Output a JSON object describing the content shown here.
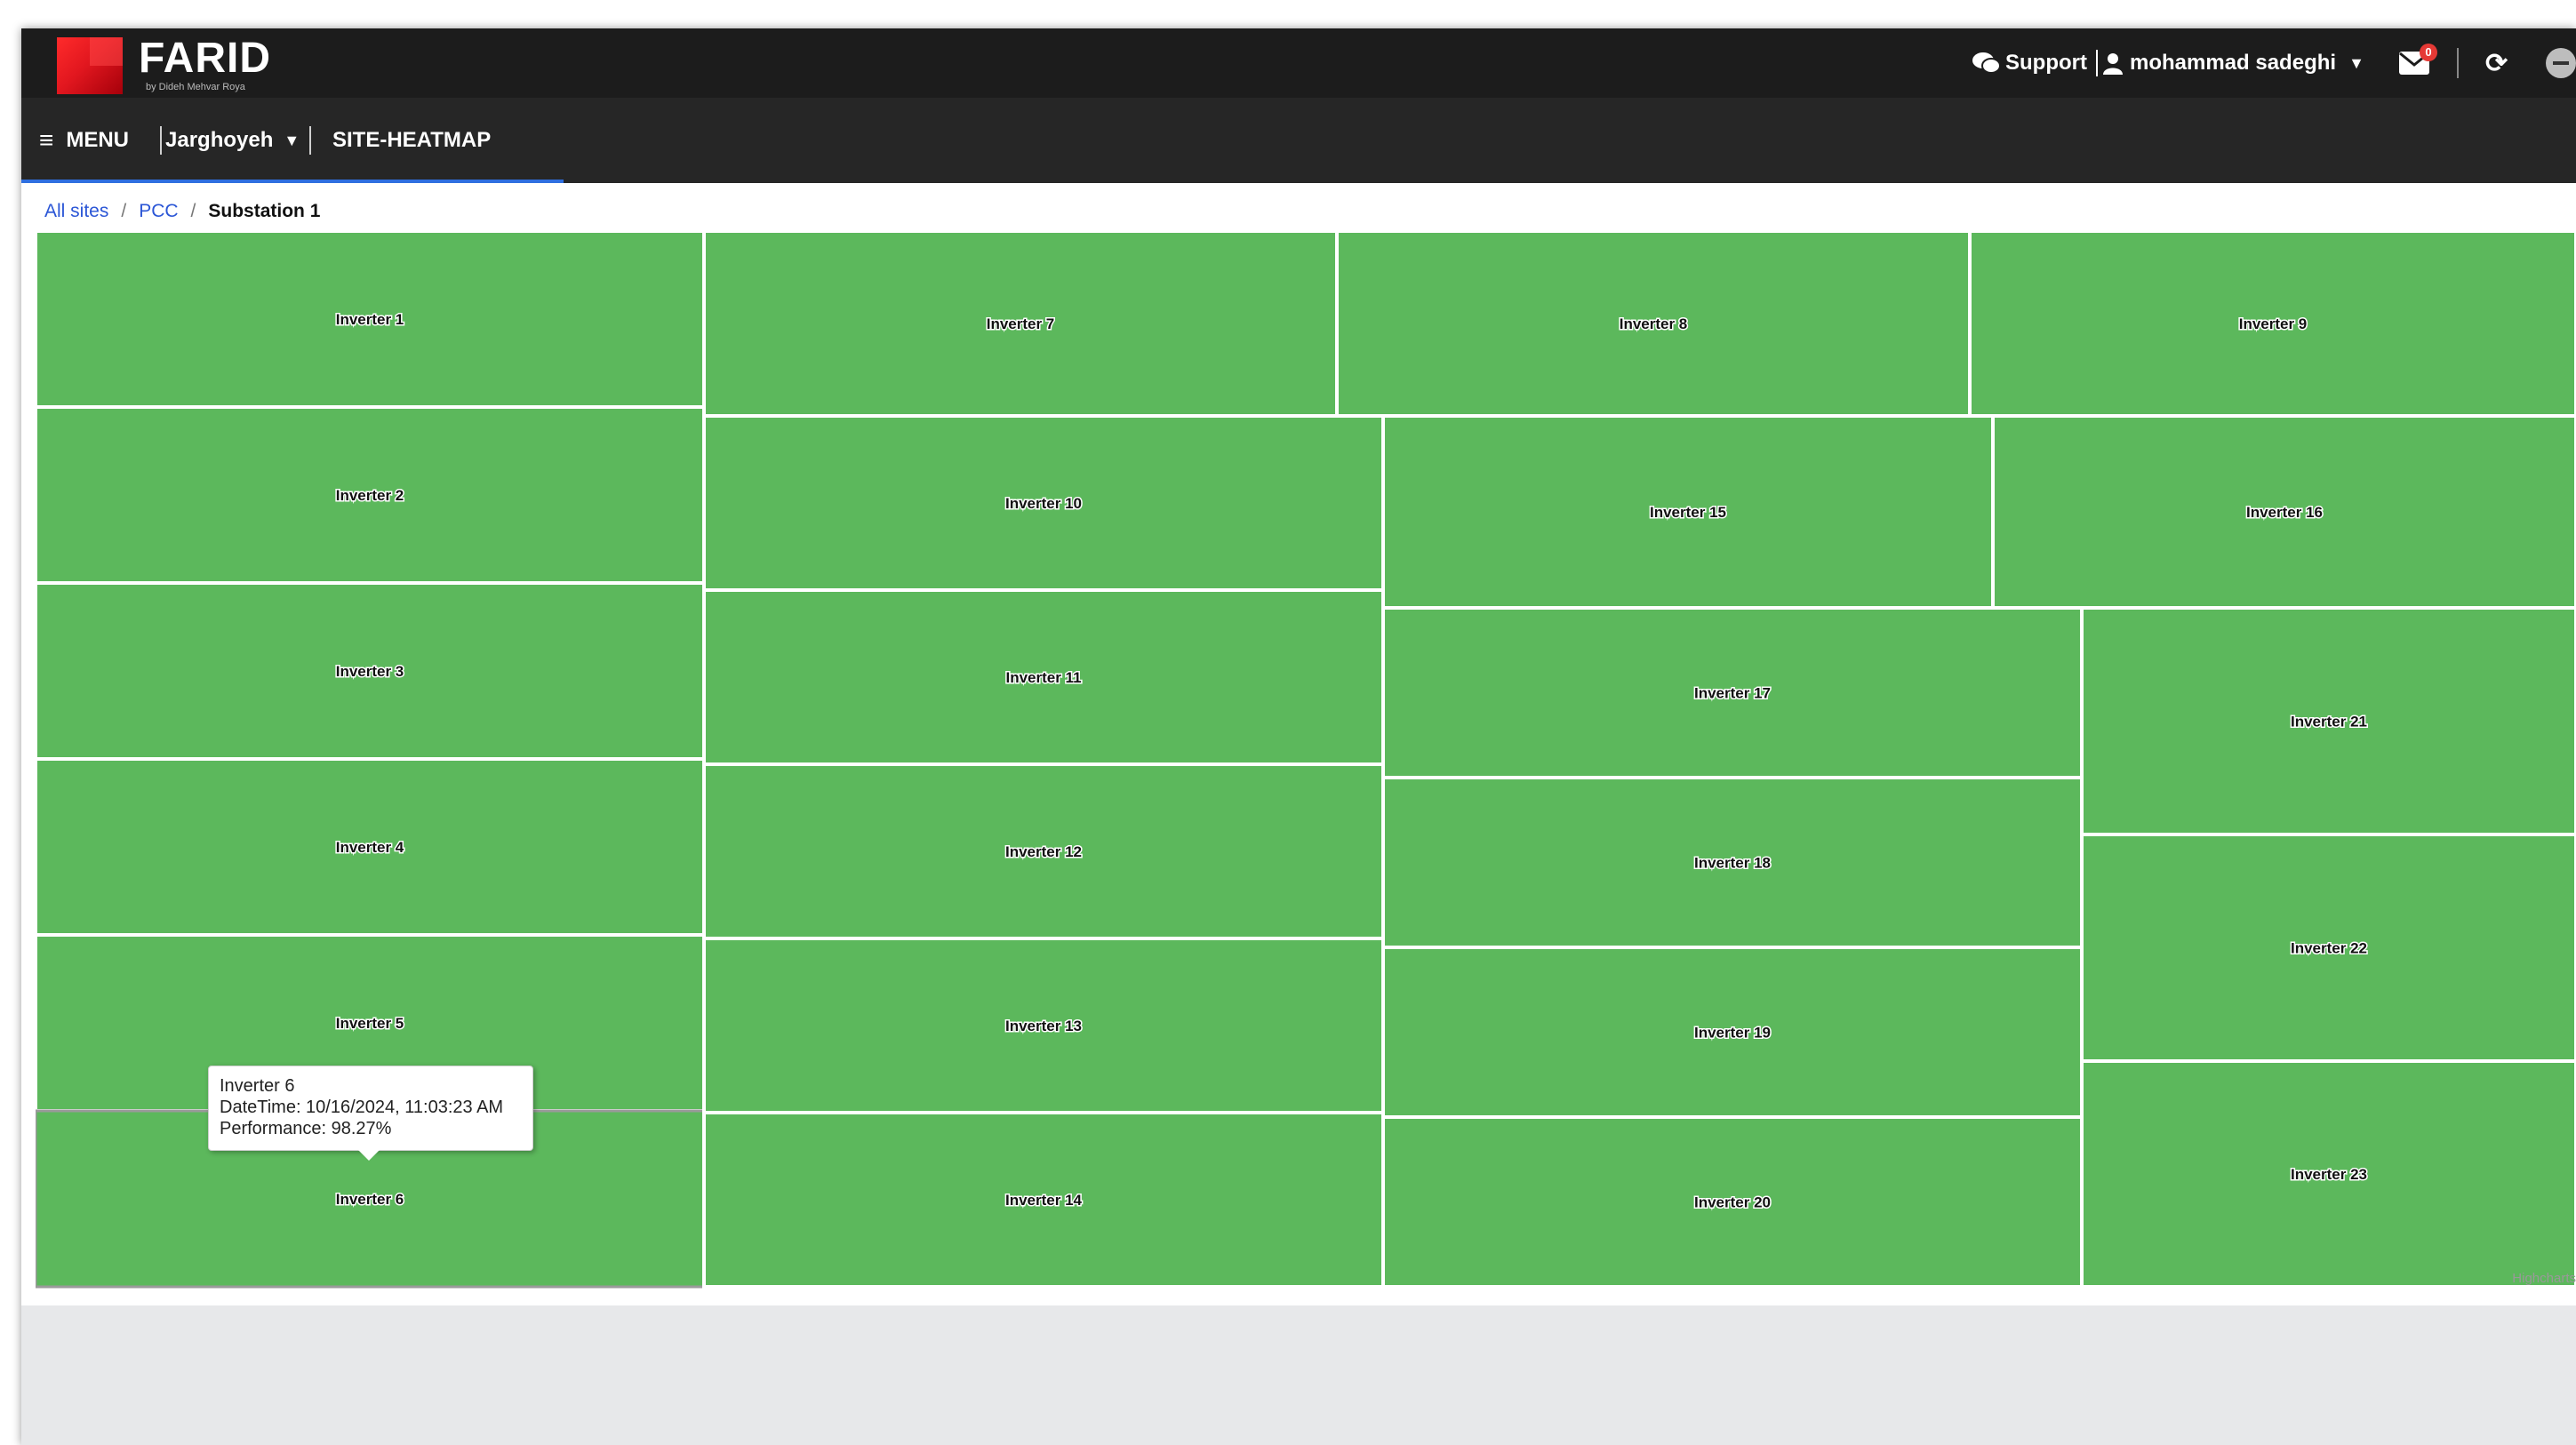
{
  "header": {
    "brand": "FARID",
    "brand_sub": "by Dideh Mehvar Roya",
    "support_label": "Support",
    "user_name": "mohammad sadeghi",
    "notification_count": "0"
  },
  "nav": {
    "menu_label": "MENU",
    "site_selector": "Jarghoyeh",
    "page_label": "SITE-HEATMAP"
  },
  "breadcrumb": {
    "all_sites": "All sites",
    "pcc": "PCC",
    "current": "Substation 1"
  },
  "tooltip": {
    "title": "Inverter 6",
    "datetime": "DateTime: 10/16/2024, 11:03:23 AM",
    "performance": "Performance: 98.27%"
  },
  "credits": "Highcharts",
  "colors": {
    "tile_green": "#5cb85c",
    "topbar": "#1c1c1c",
    "navbar": "#262626",
    "link": "#2b56d6"
  },
  "chart_data": {
    "type": "heatmap",
    "title": "",
    "cells": [
      {
        "name": "Inverter 1"
      },
      {
        "name": "Inverter 2"
      },
      {
        "name": "Inverter 3"
      },
      {
        "name": "Inverter 4"
      },
      {
        "name": "Inverter 5"
      },
      {
        "name": "Inverter 6",
        "datetime": "10/16/2024, 11:03:23 AM",
        "performance": 98.27
      },
      {
        "name": "Inverter 7"
      },
      {
        "name": "Inverter 8"
      },
      {
        "name": "Inverter 9"
      },
      {
        "name": "Inverter 10"
      },
      {
        "name": "Inverter 11"
      },
      {
        "name": "Inverter 12"
      },
      {
        "name": "Inverter 13"
      },
      {
        "name": "Inverter 14"
      },
      {
        "name": "Inverter 15"
      },
      {
        "name": "Inverter 16"
      },
      {
        "name": "Inverter 17"
      },
      {
        "name": "Inverter 18"
      },
      {
        "name": "Inverter 19"
      },
      {
        "name": "Inverter 20"
      },
      {
        "name": "Inverter 21"
      },
      {
        "name": "Inverter 22"
      },
      {
        "name": "Inverter 23"
      }
    ]
  }
}
